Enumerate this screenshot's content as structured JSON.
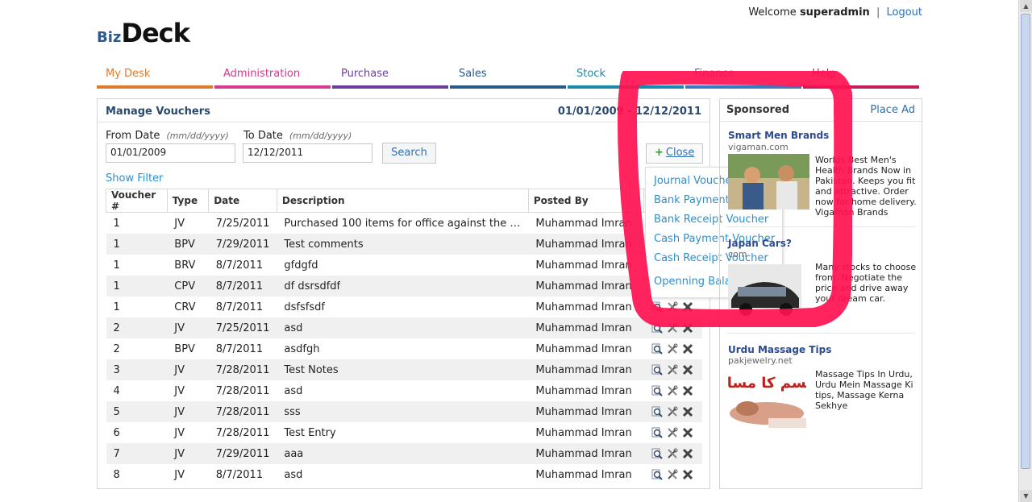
{
  "header": {
    "welcome_prefix": "Welcome",
    "username": "superadmin",
    "separator": "|",
    "logout_label": "Logout",
    "logo_biz": "Biz",
    "logo_deck": "Deck"
  },
  "nav": {
    "tabs": [
      {
        "label": "My Desk",
        "color": "#e07a2a"
      },
      {
        "label": "Administration",
        "color": "#d63a8c"
      },
      {
        "label": "Purchase",
        "color": "#6a3e9a"
      },
      {
        "label": "Sales",
        "color": "#2a5a8a"
      },
      {
        "label": "Stock",
        "color": "#1a8aaa"
      },
      {
        "label": "Finance",
        "color": "#3a7ac0"
      },
      {
        "label": "Help",
        "color": "#c21f5a"
      }
    ]
  },
  "main": {
    "title": "Manage Vouchers",
    "date_range": "01/01/2009 - 12/12/2011",
    "from_label": "From Date",
    "from_hint": "(mm/dd/yyyy)",
    "from_value": "01/01/2009",
    "to_label": "To Date",
    "to_hint": "(mm/dd/yyyy)",
    "to_value": "12/12/2011",
    "search_label": "Search",
    "show_filter_label": "Show Filter",
    "close_plus": "+",
    "close_label": "Close",
    "columns": [
      "Voucher #",
      "Type",
      "Date",
      "Description",
      "Posted By"
    ],
    "rows": [
      [
        "1",
        "JV",
        "7/25/2011",
        "Purchased 100 items for office against the i …",
        "Muhammad Imran"
      ],
      [
        "1",
        "BPV",
        "7/29/2011",
        "Test comments",
        "Muhammad Imran"
      ],
      [
        "1",
        "BRV",
        "8/7/2011",
        "gfdgfd",
        "Muhammad Imran"
      ],
      [
        "1",
        "CPV",
        "8/7/2011",
        "df dsrsdfdf",
        "Muhammad Imran"
      ],
      [
        "1",
        "CRV",
        "8/7/2011",
        "dsfsfsdf",
        "Muhammad Imran"
      ],
      [
        "2",
        "JV",
        "7/25/2011",
        "asd",
        "Muhammad Imran"
      ],
      [
        "2",
        "BPV",
        "8/7/2011",
        "asdfgh",
        "Muhammad Imran"
      ],
      [
        "3",
        "JV",
        "7/28/2011",
        "Test Notes",
        "Muhammad Imran"
      ],
      [
        "4",
        "JV",
        "7/28/2011",
        "asd",
        "Muhammad Imran"
      ],
      [
        "5",
        "JV",
        "7/28/2011",
        "sss",
        "Muhammad Imran"
      ],
      [
        "6",
        "JV",
        "7/28/2011",
        "Test Entry",
        "Muhammad Imran"
      ],
      [
        "7",
        "JV",
        "7/29/2011",
        "aaa",
        "Muhammad Imran"
      ],
      [
        "8",
        "JV",
        "8/7/2011",
        "asd",
        "Muhammad Imran"
      ]
    ]
  },
  "dropdown": {
    "items": [
      "Journal Voucher",
      "Bank Payment Voucher",
      "Bank Receipt Voucher",
      "Cash Payment Voucher",
      "Cash Receipt Voucher",
      "Openning Balance"
    ]
  },
  "sponsored": {
    "title": "Sponsored",
    "place_ad": "Place Ad",
    "ads": [
      {
        "title": "Smart Men Brands",
        "url": "vigaman.com",
        "text": "Worlds Best Men's Health Brands Now in Pakistan. Keeps you fit and attractive. Order now for home delivery. Vigaman Brands"
      },
      {
        "title": "Japan Cars?",
        "url": "com",
        "text": "Many stocks to choose from. Negotiate the price and drive away your dream car."
      },
      {
        "title": "Urdu Massage Tips",
        "url": "pakjewelry.net",
        "text": "Massage Tips In Urdu, Urdu Mein Massage Ki tips, Massage Kerna Sekhye",
        "image_text": "جسم کا مساج"
      }
    ]
  },
  "colors": {
    "highlight": "#ff1050",
    "link": "#2a8fd0",
    "title": "#2b4a6f"
  }
}
